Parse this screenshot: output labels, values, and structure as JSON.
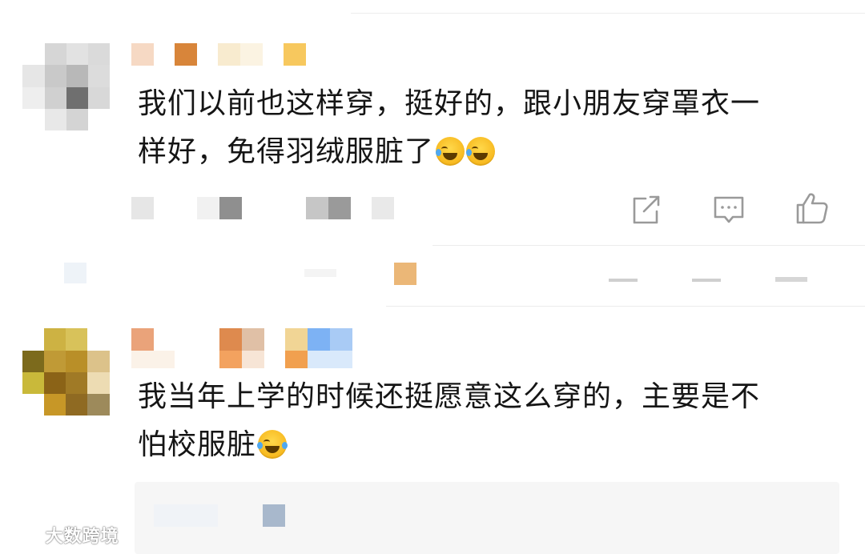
{
  "comments": [
    {
      "text_line1": "我们以前也这样穿，挺好的，跟小朋友穿罩衣一",
      "text_line2": "样好，免得羽绒服脏了",
      "emojis": [
        "crying-laughing-emoji",
        "crying-laughing-emoji"
      ]
    },
    {
      "text_line1": "我当年上学的时候还挺愿意这么穿的，主要是不",
      "text_line2": "怕校服脏",
      "emojis": [
        "laughing-emoji"
      ]
    }
  ],
  "actions": {
    "icons": [
      "share-icon",
      "comment-icon",
      "like-icon"
    ]
  },
  "watermark": {
    "text": "大数跨境"
  },
  "colors": {
    "text": "#151515",
    "divider": "#ececec",
    "icon": "#9a9a9a",
    "reply_bg": "#f6f6f6"
  }
}
